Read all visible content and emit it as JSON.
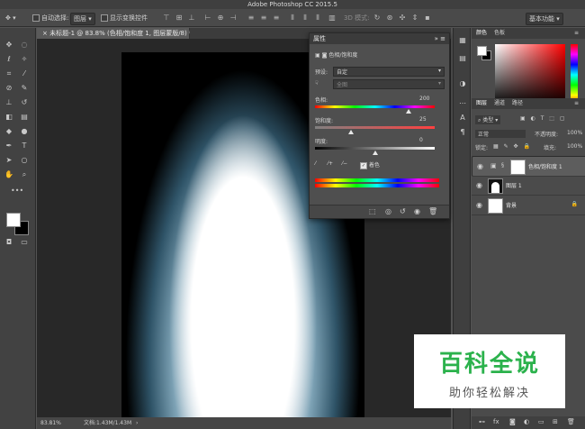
{
  "app_title": "Adobe Photoshop CC 2015.5",
  "options_bar": {
    "auto_select_label": "自动选择:",
    "auto_select_value": "图层",
    "show_transform_label": "显示变换控件",
    "mode_3d": "3D 模式:",
    "workspace": "基本功能"
  },
  "document": {
    "tab_title": "未标题-1 @ 83.8% (色相/饱和度 1, 图层蒙版/8) *",
    "zoom": "83.81%",
    "doc_info": "文档:1.43M/1.43M"
  },
  "properties": {
    "title": "属性",
    "adjustment_name": "色相/饱和度",
    "preset_label": "预设:",
    "preset_value": "自定",
    "channel_value": "全图",
    "hue_label": "色相:",
    "hue_value": "200",
    "hue_fraction": 0.78,
    "saturation_label": "饱和度:",
    "saturation_value": "25",
    "saturation_fraction": 0.3,
    "lightness_label": "明度:",
    "lightness_value": "0",
    "lightness_fraction": 0.5,
    "colorize_label": "着色"
  },
  "color_panel": {
    "tabs": [
      "颜色",
      "色板"
    ],
    "foreground": "#ffffff",
    "background": "#000000"
  },
  "layers_panel": {
    "tabs": [
      "图层",
      "通道",
      "路径"
    ],
    "filter_kind": "类型",
    "blend_mode": "正常",
    "opacity_label": "不透明度:",
    "opacity_value": "100%",
    "lock_label": "锁定:",
    "fill_label": "填充:",
    "fill_value": "100%",
    "layers": [
      {
        "name": "色相/饱和度 1",
        "selected": true,
        "kind": "adjustment"
      },
      {
        "name": "图层 1",
        "selected": false,
        "kind": "pixel"
      },
      {
        "name": "背景",
        "selected": false,
        "kind": "background"
      }
    ]
  },
  "watermark": {
    "title": "百科全说",
    "subtitle": "助你轻松解决"
  }
}
